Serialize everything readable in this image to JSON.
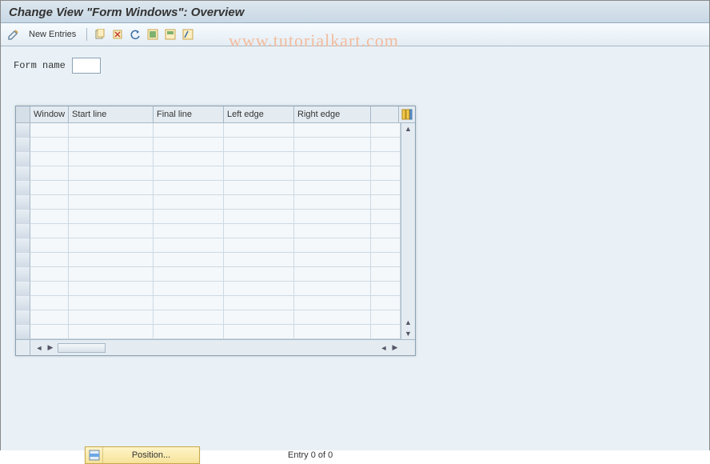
{
  "title": "Change View \"Form Windows\": Overview",
  "toolbar": {
    "new_entries_label": "New Entries"
  },
  "watermark": "www.tutorialkart.com",
  "form": {
    "name_label": "Form name",
    "name_value": ""
  },
  "grid": {
    "columns": [
      "Window",
      "Start line",
      "Final line",
      "Left edge",
      "Right edge"
    ],
    "row_count": 15
  },
  "footer": {
    "position_label": "Position...",
    "entry_status": "Entry 0 of 0"
  }
}
